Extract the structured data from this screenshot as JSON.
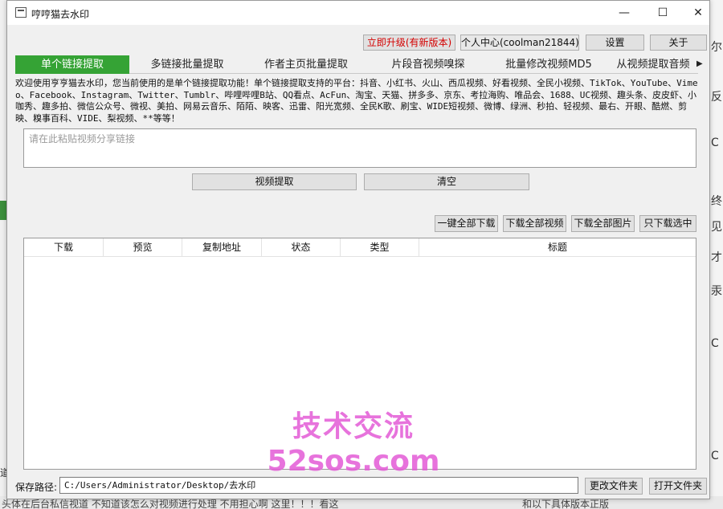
{
  "window": {
    "title": "哼哼猫去水印",
    "minimize_glyph": "—",
    "maximize_glyph": "☐",
    "close_glyph": "✕"
  },
  "top_buttons": {
    "upgrade": "立即升级(有新版本)",
    "user_center": "个人中心(coolman21844)▾",
    "settings": "设置",
    "about": "关于"
  },
  "tabs": [
    "单个链接提取",
    "多链接批量提取",
    "作者主页批量提取",
    "片段音视频嗅探",
    "批量修改视频MD5",
    "从视频提取音频"
  ],
  "tab_scroll_glyph": "▶",
  "info_text": "欢迎使用亨亨猫去水印，您当前使用的是单个链接提取功能！单个链接提取支持的平台：抖音、小红书、火山、西瓜视频、好看视频、全民小视频、TikTok、YouTube、Vimeo、Facebook、Instagram、Twitter、Tumblr、哔哩哔哩B站、QQ看点、AcFun、淘宝、天猫、拼多多、京东、考拉海购、唯品会、1688、UC视频、趣头条、皮皮虾、小咖秀、趣多拍、微信公众号、微视、美拍、网易云音乐、陌陌、映客、迅雷、阳光宽频、全民K歌、刷宝、WIDE短视频、微博、绿洲、秒拍、轻视频、最右、开眼、酷燃、剪映、糗事百科、VIDE、梨视频、**等等！",
  "link_input": {
    "placeholder": "请在此粘贴视频分享链接"
  },
  "actions": {
    "extract": "视频提取",
    "clear": "清空"
  },
  "download_buttons": {
    "download_all": "一键全部下载",
    "download_videos": "下载全部视频",
    "download_images": "下载全部图片",
    "download_selected": "只下载选中"
  },
  "table": {
    "columns": [
      "下载",
      "预览",
      "复制地址",
      "状态",
      "类型",
      "标题"
    ]
  },
  "save_path": {
    "label": "保存路径:",
    "value": "C:/Users/Administrator/Desktop/去水印",
    "change_button": "更改文件夹",
    "open_button": "打开文件夹"
  },
  "watermark": {
    "line1": "技术交流",
    "line2": "52sos.com"
  },
  "background": {
    "right_glyphs": [
      "尔",
      "反",
      "C",
      "终",
      "见",
      "才",
      "汞",
      "C",
      "C"
    ],
    "bottom_text_left": "头体在后台私信视道 不知道该怎么对视频进行处理 不用担心啊 这里！！！看这",
    "bottom_text_right": "和以下具体版本正版",
    "left_text": "道"
  },
  "colors": {
    "accent_green": "#35a335",
    "upgrade_red": "#d40000",
    "watermark_magenta": "#e35bd6"
  }
}
